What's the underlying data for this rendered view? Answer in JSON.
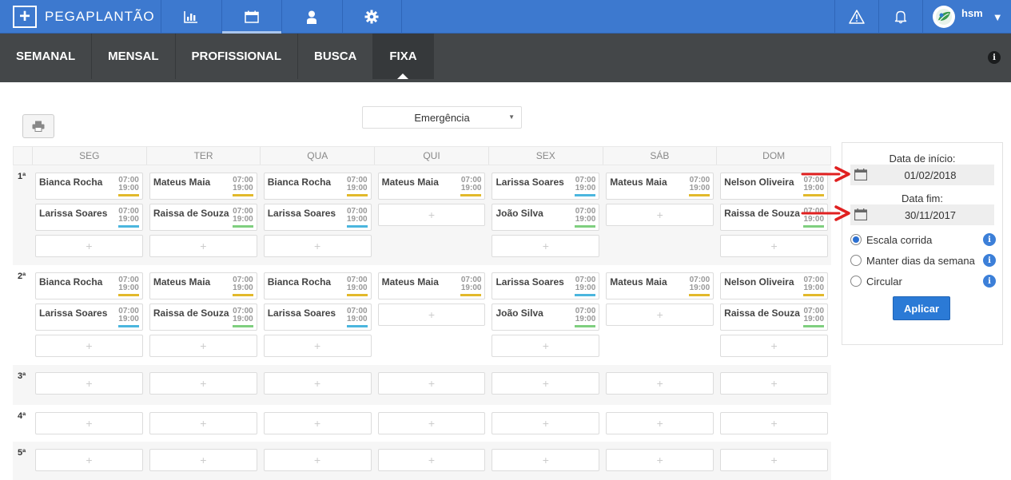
{
  "app": {
    "name": "PEGAPLANTÃO",
    "logo_glyph": "+"
  },
  "topnav": [
    {
      "icon": "bar-chart-icon"
    },
    {
      "icon": "calendar-icon",
      "active": true
    },
    {
      "icon": "person-icon"
    },
    {
      "icon": "gear-icon"
    }
  ],
  "topright": {
    "alert_icon": "warning-icon",
    "bell_icon": "bell-icon",
    "user": "hsm"
  },
  "tabs": [
    "SEMANAL",
    "MENSAL",
    "PROFISSIONAL",
    "BUSCA",
    "FIXA"
  ],
  "active_tab": "FIXA",
  "filter": {
    "selected": "Emergência"
  },
  "days": [
    "SEG",
    "TER",
    "QUA",
    "QUI",
    "SEX",
    "SÁB",
    "DOM"
  ],
  "time_start": "07:00",
  "time_end": "19:00",
  "colors": {
    "yellow": "#e2b92b",
    "blue": "#4bb6de",
    "green": "#7fcf7f",
    "topbar": "#3d79cf",
    "apply": "#2b7ad6"
  },
  "weeks": [
    {
      "label": "1ª",
      "shifts": [
        [
          {
            "name": "Bianca Rocha",
            "color": "yellow"
          },
          {
            "name": "Larissa Soares",
            "color": "blue"
          }
        ],
        [
          {
            "name": "Mateus Maia",
            "color": "yellow"
          },
          {
            "name": "Raissa de Souza",
            "color": "green"
          }
        ],
        [
          {
            "name": "Bianca Rocha",
            "color": "yellow"
          },
          {
            "name": "Larissa Soares",
            "color": "blue"
          }
        ],
        [
          {
            "name": "Mateus Maia",
            "color": "yellow"
          }
        ],
        [
          {
            "name": "Larissa Soares",
            "color": "blue"
          },
          {
            "name": "João Silva",
            "color": "green"
          }
        ],
        [
          {
            "name": "Mateus Maia",
            "color": "yellow"
          }
        ],
        [
          {
            "name": "Nelson Oliveira",
            "color": "yellow"
          },
          {
            "name": "Raissa de Souza",
            "color": "green"
          }
        ]
      ]
    },
    {
      "label": "2ª",
      "shifts": [
        [
          {
            "name": "Bianca Rocha",
            "color": "yellow"
          },
          {
            "name": "Larissa Soares",
            "color": "blue"
          }
        ],
        [
          {
            "name": "Mateus Maia",
            "color": "yellow"
          },
          {
            "name": "Raissa de Souza",
            "color": "green"
          }
        ],
        [
          {
            "name": "Bianca Rocha",
            "color": "yellow"
          },
          {
            "name": "Larissa Soares",
            "color": "blue"
          }
        ],
        [
          {
            "name": "Mateus Maia",
            "color": "yellow"
          }
        ],
        [
          {
            "name": "Larissa Soares",
            "color": "blue"
          },
          {
            "name": "João Silva",
            "color": "green"
          }
        ],
        [
          {
            "name": "Mateus Maia",
            "color": "yellow"
          }
        ],
        [
          {
            "name": "Nelson Oliveira",
            "color": "yellow"
          },
          {
            "name": "Raissa de Souza",
            "color": "green"
          }
        ]
      ]
    },
    {
      "label": "3ª",
      "shifts": [
        [],
        [],
        [],
        [],
        [],
        [],
        []
      ]
    },
    {
      "label": "4ª",
      "shifts": [
        [],
        [],
        [],
        [],
        [],
        [],
        []
      ]
    },
    {
      "label": "5ª",
      "shifts": [
        [],
        [],
        [],
        [],
        [],
        [],
        []
      ]
    }
  ],
  "panel": {
    "start_label": "Data de início:",
    "start_value": "01/02/2018",
    "end_label": "Data fim:",
    "end_value": "30/11/2017",
    "options": [
      {
        "label": "Escala corrida",
        "checked": true
      },
      {
        "label": "Manter dias da semana",
        "checked": false
      },
      {
        "label": "Circular",
        "checked": false
      }
    ],
    "apply_label": "Aplicar"
  }
}
